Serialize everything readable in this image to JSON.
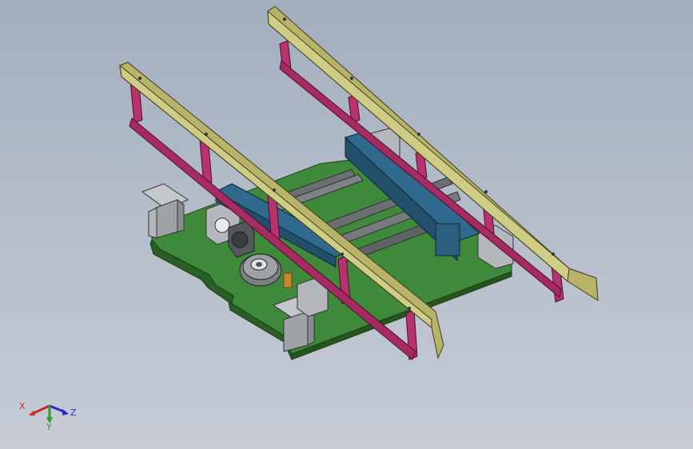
{
  "triad": {
    "x_label": "X",
    "y_label": "Y",
    "z_label": "Z"
  },
  "colors": {
    "background_top": "#a3aebd",
    "background_bottom": "#c7ccd5",
    "base_plate": "#3f8a3a",
    "rail": "#b7b46a",
    "rail_posts": "#b8336e",
    "carriage": "#2f6a8e",
    "shaft": "#6c6f72",
    "bracket": "#b8bcc0",
    "x_axis": "#cc2a2a",
    "y_axis": "#2aa02a",
    "z_axis": "#2a2acc"
  }
}
